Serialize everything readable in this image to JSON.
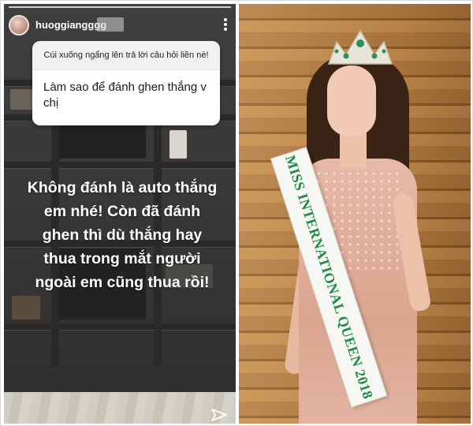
{
  "story": {
    "username": "huoggiangggg",
    "question_header": "Cúi xuống ngẩng lên trả lời câu hỏi liền nè!",
    "question": "Làm sao để đánh ghen thắng v chị",
    "answer": "Không đánh là auto thắng\nem nhé! Còn đã đánh\nghen thì dù thắng hay\nthua trong mắt người\nngoài em cũng thua rồi!",
    "icons": [
      "more-icon",
      "send-icon"
    ]
  },
  "photo": {
    "sash_text": "MISS INTERNATIONAL QUEEN 2018",
    "colors": {
      "sash_text": "#1f8a45",
      "wall": "#b07a3f",
      "dress": "#e8b9a8"
    }
  }
}
